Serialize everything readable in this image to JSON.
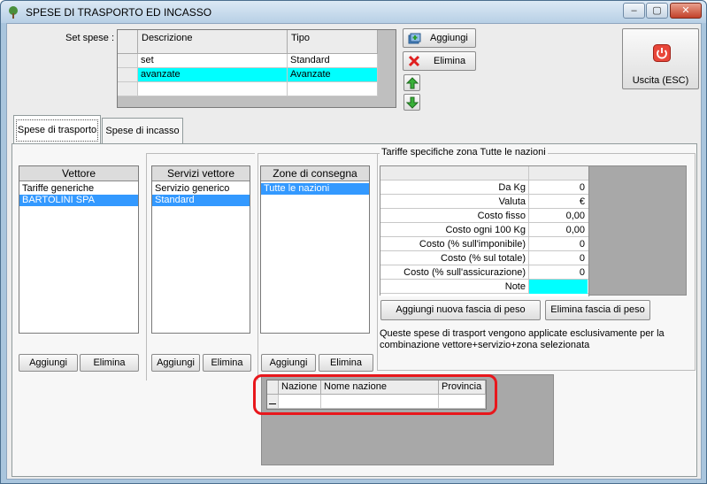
{
  "window": {
    "title": "SPESE DI TRASPORTO ED INCASSO",
    "minimize": "–",
    "maximize": "▢",
    "close": "✕"
  },
  "set_spese": {
    "label": "Set spese :",
    "columns": [
      "Descrizione",
      "Tipo"
    ],
    "rows": [
      {
        "descrizione": "set",
        "tipo": "Standard"
      },
      {
        "descrizione": "avanzate",
        "tipo": "Avanzate"
      }
    ]
  },
  "toolbar": {
    "add_label": "Aggiungi",
    "delete_label": "Elimina",
    "exit_label": "Uscita (ESC)"
  },
  "tabs": [
    {
      "label": "Spese di trasporto"
    },
    {
      "label": "Spese di incasso"
    }
  ],
  "vettore": {
    "header": "Vettore",
    "items": [
      "Tariffe generiche",
      "BARTOLINI SPA"
    ],
    "add_label": "Aggiungi",
    "delete_label": "Elimina"
  },
  "servizi": {
    "header": "Servizi vettore",
    "items": [
      "Servizio generico",
      "Standard"
    ],
    "add_label": "Aggiungi",
    "delete_label": "Elimina"
  },
  "zone": {
    "header": "Zone di consegna",
    "items": [
      "Tutte le nazioni"
    ],
    "add_label": "Aggiungi",
    "delete_label": "Elimina"
  },
  "tariffe": {
    "legend": "Tariffe specifiche zona Tutte le nazioni",
    "rows": [
      {
        "key": "Da Kg",
        "value": "0"
      },
      {
        "key": "Valuta",
        "value": "€"
      },
      {
        "key": "Costo fisso",
        "value": "0,00"
      },
      {
        "key": "Costo ogni 100 Kg",
        "value": "0,00"
      },
      {
        "key": "Costo (% sull'imponibile)",
        "value": "0"
      },
      {
        "key": "Costo (% sul totale)",
        "value": "0"
      },
      {
        "key": "Costo (% sull'assicurazione)",
        "value": "0"
      },
      {
        "key": "Note",
        "value": ""
      }
    ],
    "add_band_label": "Aggiungi nuova fascia di peso",
    "delete_band_label": "Elimina fascia di peso",
    "info_line1": "Queste spese di trasport vengono applicate esclusivamente per la",
    "info_line2": "combinazione vettore+servizio+zona selezionata"
  },
  "nazioni": {
    "columns": [
      "Nazione",
      "Nome nazione",
      "Provincia"
    ]
  },
  "colors": {
    "selection_cyan": "#00ffff",
    "selection_blue": "#3399ff",
    "highlight_red": "#e8171c"
  }
}
